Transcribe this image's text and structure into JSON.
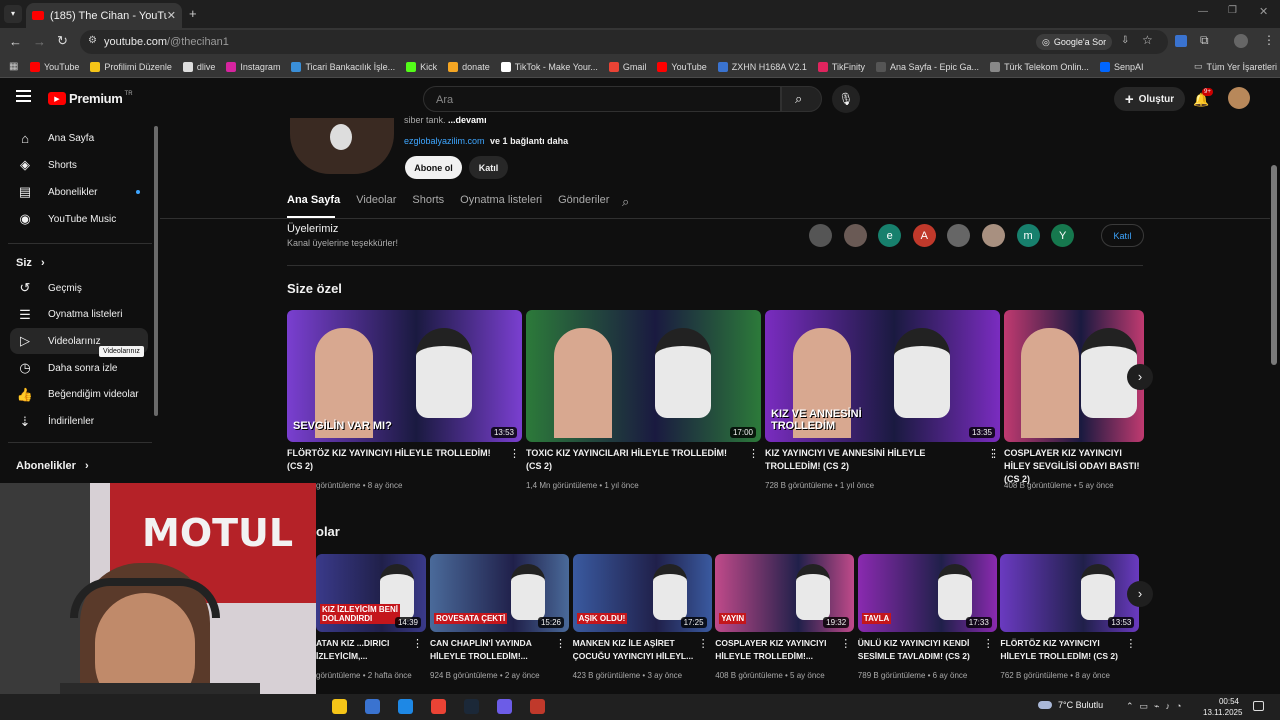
{
  "browser": {
    "tab_title": "(185) The Cihan - YouTube",
    "url_host": "youtube.com",
    "url_path": "/@thecihan1",
    "google_btn": "Google'a Sor",
    "bookmarks": [
      "YouTube",
      "Profilimi Düzenle",
      "dlive",
      "Instagram",
      "Ticari Bankacılık İşle...",
      "Kick",
      "donate",
      "TikTok - Make Your...",
      "Gmail",
      "YouTube",
      "ZXHN H168A V2.1",
      "TikFinity",
      "Ana Sayfa - Epic Ga...",
      "Türk Telekom Onlin...",
      "SenpAI"
    ],
    "all_bookmarks": "Tüm Yer İşaretleri"
  },
  "header": {
    "logo": "Premium",
    "logo_sup": "TR",
    "search_placeholder": "Ara",
    "create_label": "Oluştur",
    "notif_count": "9+"
  },
  "sidebar": {
    "main": [
      {
        "label": "Ana Sayfa",
        "icon": "home-icon"
      },
      {
        "label": "Shorts",
        "icon": "shorts-icon"
      },
      {
        "label": "Abonelikler",
        "icon": "subscriptions-icon"
      },
      {
        "label": "YouTube Music",
        "icon": "music-icon"
      }
    ],
    "you_header": "Siz",
    "you": [
      {
        "label": "Geçmiş",
        "icon": "history-icon"
      },
      {
        "label": "Oynatma listeleri",
        "icon": "playlist-icon"
      },
      {
        "label": "Videolarınız",
        "icon": "your-videos-icon"
      },
      {
        "label": "Daha sonra izle",
        "icon": "watch-later-icon"
      },
      {
        "label": "Beğendiğim videolar",
        "icon": "like-icon"
      },
      {
        "label": "İndirilenler",
        "icon": "download-icon"
      }
    ],
    "subs_header": "Abonelikler",
    "tooltip": "Videolarınız"
  },
  "channel": {
    "desc_snippet": "siber tank.",
    "more": "...devamı",
    "link": "ezglobalyazilim.com",
    "link_more": "ve 1 bağlantı daha",
    "subscribe": "Abone ol",
    "join": "Katıl",
    "tabs": [
      "Ana Sayfa",
      "Videolar",
      "Shorts",
      "Oynatma listeleri",
      "Gönderiler"
    ],
    "members_title": "Üyelerimiz",
    "members_sub": "Kanal üyelerine teşekkürler!",
    "member_letters": [
      "",
      "",
      "e",
      "A",
      "",
      "",
      "m",
      "Y"
    ],
    "members_join": "Katıl"
  },
  "section1": {
    "title": "Size özel",
    "videos": [
      {
        "title": "FLÖRTÖZ KIZ YAYINCIYI HİLEYLE TROLLEDİM! (CS 2)",
        "duration": "13:53",
        "meta": "görüntüleme • 8 ay önce",
        "thumb_color": "#7a3fd0"
      },
      {
        "title": "TOXIC KIZ YAYINCILARI HİLEYLE TROLLEDİM! (CS 2)",
        "duration": "17:00",
        "meta": "1,4 Mn görüntüleme • 1 yıl önce",
        "thumb_color": "#2c7a3a"
      },
      {
        "title": "KIZ YAYINCIYI VE ANNESİNİ HİLEYLE TROLLEDİM! (CS 2)",
        "duration": "13:35",
        "meta": "728 B görüntüleme • 1 yıl önce",
        "thumb_color": "#7a2cc0"
      },
      {
        "title": "COSPLAYER KIZ YAYINCIYI HİLEY SEVGİLİSİ ODAYI BASTI! (CS 2)",
        "duration": "",
        "meta": "408 B görüntüleme • 5 ay önce",
        "thumb_color": "#c03a70"
      }
    ],
    "thumb_texts": [
      "SEVGİLİN VAR MI?",
      "",
      "KIZ VE ANNESİNİ TROLLEDİM",
      ""
    ]
  },
  "section2": {
    "title": "olar",
    "videos": [
      {
        "title": "ATAN KIZ ...DIRICI İZLEYİCİM,...",
        "duration": "14:39",
        "meta": "görüntüleme • 2 hafta önce",
        "thumb_color": "#3a3a8a",
        "text": "KIZ İZLEYİCİM BENİ DOLANDIRDI"
      },
      {
        "title": "CAN CHAPLİN'İ YAYINDA HİLEYLE TROLLEDİM!...",
        "duration": "15:26",
        "meta": "924 B görüntüleme • 2 ay önce",
        "thumb_color": "#4a6a9a",
        "text": "ROVESATA ÇEKTİ"
      },
      {
        "title": "MANKEN KIZ İLE AŞİRET ÇOCUĞU YAYINCIYI HİLEYL...",
        "duration": "17:25",
        "meta": "423 B görüntüleme • 3 ay önce",
        "thumb_color": "#3a5aa0",
        "text": "AŞIK OLDU!"
      },
      {
        "title": "COSPLAYER KIZ YAYINCIYI HİLEYLE TROLLEDİM!...",
        "duration": "19:32",
        "meta": "408 B görüntüleme • 5 ay önce",
        "thumb_color": "#c04a8a",
        "text": "YAYIN"
      },
      {
        "title": "ÜNLÜ KIZ YAYINCIYI KENDİ SESİMLE TAVLADIM! (CS 2)",
        "duration": "17:33",
        "meta": "789 B görüntüleme • 6 ay önce",
        "thumb_color": "#8a2ab0",
        "text": "TAVLA"
      },
      {
        "title": "FLÖRTÖZ KIZ YAYINCIYI HİLEYLE TROLLEDİM! (CS 2)",
        "duration": "13:53",
        "meta": "762 B görüntüleme • 8 ay önce",
        "thumb_color": "#6a3ac0",
        "text": ""
      }
    ]
  },
  "webcam": {
    "banner": "MOTUL"
  },
  "taskbar": {
    "weather": "7°C  Bulutlu",
    "time": "00:54",
    "date": "13.11.2025"
  }
}
